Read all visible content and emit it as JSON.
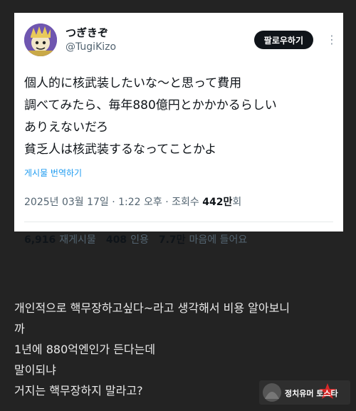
{
  "tweet": {
    "display_name": "つぎきぞ",
    "handle": "@TugiKizo",
    "follow_label": "팔로우하기",
    "more_icon": "⋮",
    "lines": [
      "個人的に核武装したいな〜と思って費用",
      "調べてみたら、毎年880億円とかかかるらしい",
      "ありえないだろ",
      "貧乏人は核武装するなってことかよ"
    ],
    "translate_label": "게시물 번역하기",
    "timestamp": "2025년 03월 17일 · 1:22 오후 · 조회수",
    "views_number": "442만",
    "views_suffix": "회",
    "stats": [
      {
        "number": "6,916",
        "label": "재게시물"
      },
      {
        "number": "408",
        "label": "인용"
      },
      {
        "number": "7.7만",
        "label": "마음에 들어요"
      }
    ]
  },
  "caption": {
    "lines": [
      "개인적으로 핵무장하고싶다~라고 생각해서 비용 알아보니",
      "까",
      "1년에 880억엔인가 든다는데",
      "말이되냐",
      "거지는 핵무장하지 말라고?"
    ]
  },
  "watermark": {
    "text": "정치유머 토스타"
  },
  "colors": {
    "background": "#232323",
    "card": "#ffffff",
    "link": "#1d9bf0",
    "follow_button": "#0f1419"
  }
}
